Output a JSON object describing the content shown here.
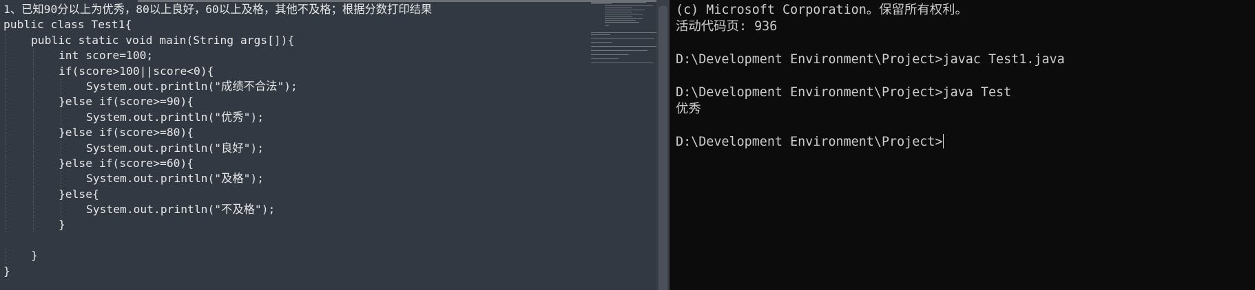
{
  "editor": {
    "lines": [
      {
        "indent": 0,
        "text": "1、已知90分以上为优秀，80以上良好，60以上及格，其他不及格；根据分数打印结果"
      },
      {
        "indent": 0,
        "text": "public class Test1{"
      },
      {
        "indent": 1,
        "text": "public static void main(String args[]){"
      },
      {
        "indent": 2,
        "text": "int score=100;"
      },
      {
        "indent": 2,
        "text": "if(score>100||score<0){"
      },
      {
        "indent": 3,
        "text": "System.out.println(\"成绩不合法\");"
      },
      {
        "indent": 2,
        "text": "}else if(score>=90){"
      },
      {
        "indent": 3,
        "text": "System.out.println(\"优秀\");"
      },
      {
        "indent": 2,
        "text": "}else if(score>=80){"
      },
      {
        "indent": 3,
        "text": "System.out.println(\"良好\");"
      },
      {
        "indent": 2,
        "text": "}else if(score>=60){"
      },
      {
        "indent": 3,
        "text": "System.out.println(\"及格\");"
      },
      {
        "indent": 2,
        "text": "}else{"
      },
      {
        "indent": 3,
        "text": "System.out.println(\"不及格\");"
      },
      {
        "indent": 2,
        "text": "}"
      },
      {
        "indent": 0,
        "text": ""
      },
      {
        "indent": 1,
        "text": "}"
      },
      {
        "indent": 0,
        "text": "}"
      }
    ]
  },
  "terminal": {
    "lines": [
      "(c) Microsoft Corporation。保留所有权利。",
      "活动代码页: 936",
      "",
      "D:\\Development Environment\\Project>javac Test1.java",
      "",
      "D:\\Development Environment\\Project>java Test",
      "优秀",
      "",
      "D:\\Development Environment\\Project>"
    ]
  }
}
